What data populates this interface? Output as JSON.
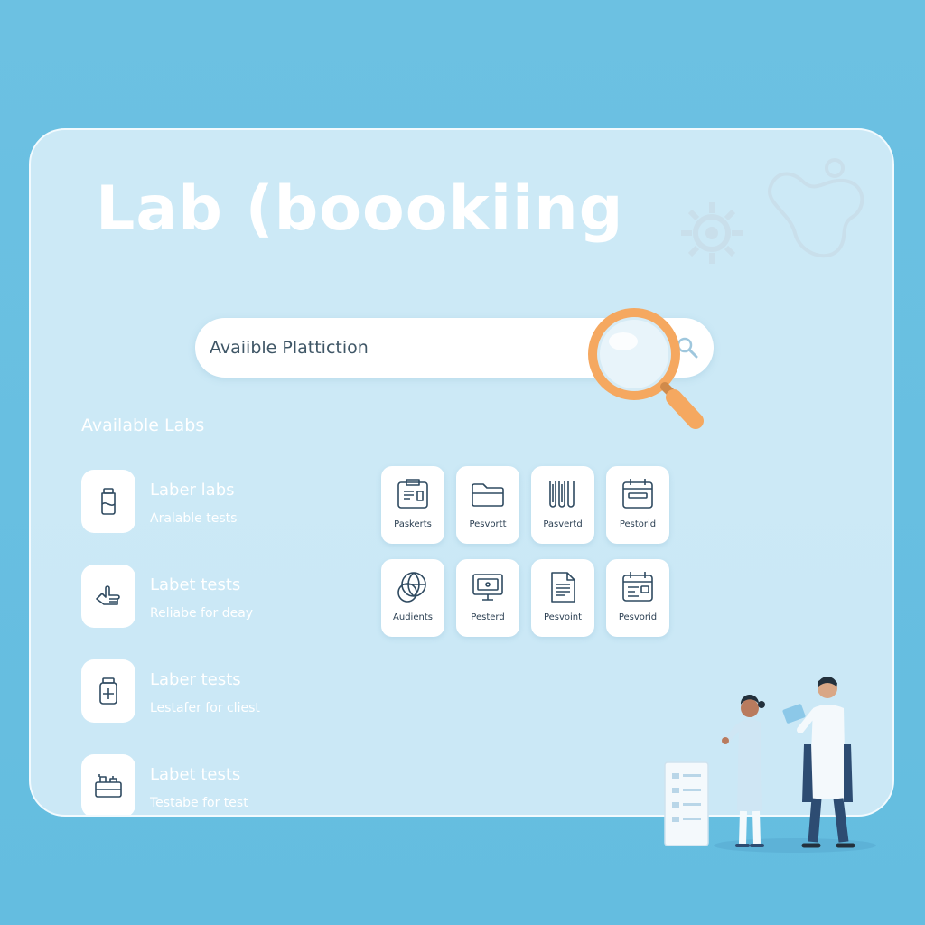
{
  "app": {
    "title": "Lab (boookiing"
  },
  "search": {
    "placeholder": "Avaiible Plattiction"
  },
  "labs_section": {
    "label": "Available Labs",
    "items": [
      {
        "name": "Laber labs",
        "desc": "Aralable tests",
        "icon": "bottle-icon"
      },
      {
        "name": "Labet tests",
        "desc": "Reliabe for deay",
        "icon": "hand-icon"
      },
      {
        "name": "Laber tests",
        "desc": "Lestafer for cliest",
        "icon": "medicine-jar-icon"
      },
      {
        "name": "Labet tests",
        "desc": "Testabe for test",
        "icon": "toolbox-icon"
      }
    ]
  },
  "tiles": [
    {
      "label": "Paskerts",
      "icon": "clipboard-icon"
    },
    {
      "label": "Pesvortt",
      "icon": "folder-icon"
    },
    {
      "label": "Pasvertd",
      "icon": "test-tubes-icon"
    },
    {
      "label": "Pestorid",
      "icon": "calendar-icon"
    },
    {
      "label": "Audients",
      "icon": "globe-icon"
    },
    {
      "label": "Pesterd",
      "icon": "monitor-icon"
    },
    {
      "label": "Pesvoint",
      "icon": "document-icon"
    },
    {
      "label": "Pesvorid",
      "icon": "schedule-icon"
    }
  ],
  "colors": {
    "background": "#6cc1e2",
    "panel": "#e2f1fa",
    "accent": "#f5a860",
    "icon_stroke": "#2f4a60"
  }
}
